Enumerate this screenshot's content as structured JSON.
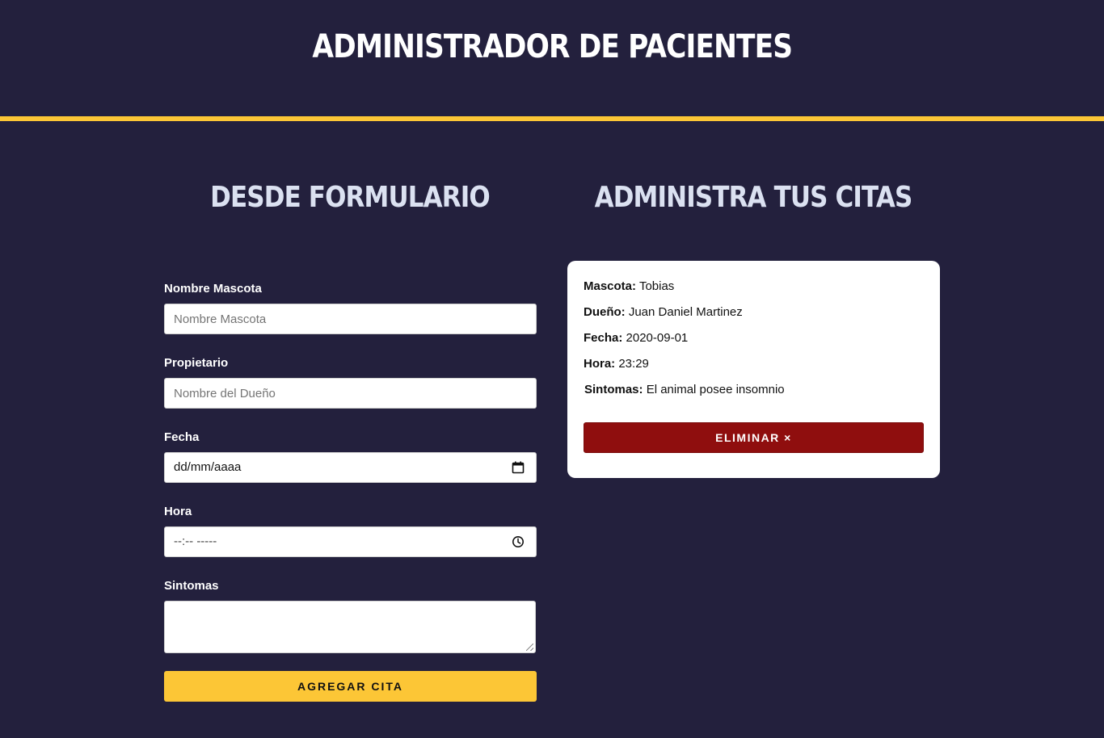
{
  "header": {
    "title": "Administrador de Pacientes"
  },
  "form_section": {
    "title": "Desde Formulario"
  },
  "list_section": {
    "title": "Administra tus Citas"
  },
  "form": {
    "pet_label": "Nombre Mascota",
    "pet_placeholder": "Nombre Mascota",
    "owner_label": "Propietario",
    "owner_placeholder": "Nombre del Dueño",
    "date_label": "Fecha",
    "date_value": "dd/mm/aaaa",
    "date_icon": "calendar-icon",
    "time_label": "Hora",
    "time_value": "--:-- -----",
    "time_icon": "clock-icon",
    "symptoms_label": "Sintomas",
    "submit_label": "Agregar Cita"
  },
  "appointment": {
    "pet_key": "Mascota:",
    "pet": "Tobias",
    "owner_key": "Dueño:",
    "owner": "Juan Daniel Martinez",
    "date_key": "Fecha:",
    "date": "2020-09-01",
    "time_key": "Hora:",
    "time": "23:29",
    "symptoms_key": "Sintomas:",
    "symptoms": "El animal posee insomnio",
    "delete_label": "Eliminar ×"
  },
  "colors": {
    "background": "#23203d",
    "accent": "#fcc636",
    "danger": "#8f0e0e",
    "section_title": "#dbe1f1"
  }
}
